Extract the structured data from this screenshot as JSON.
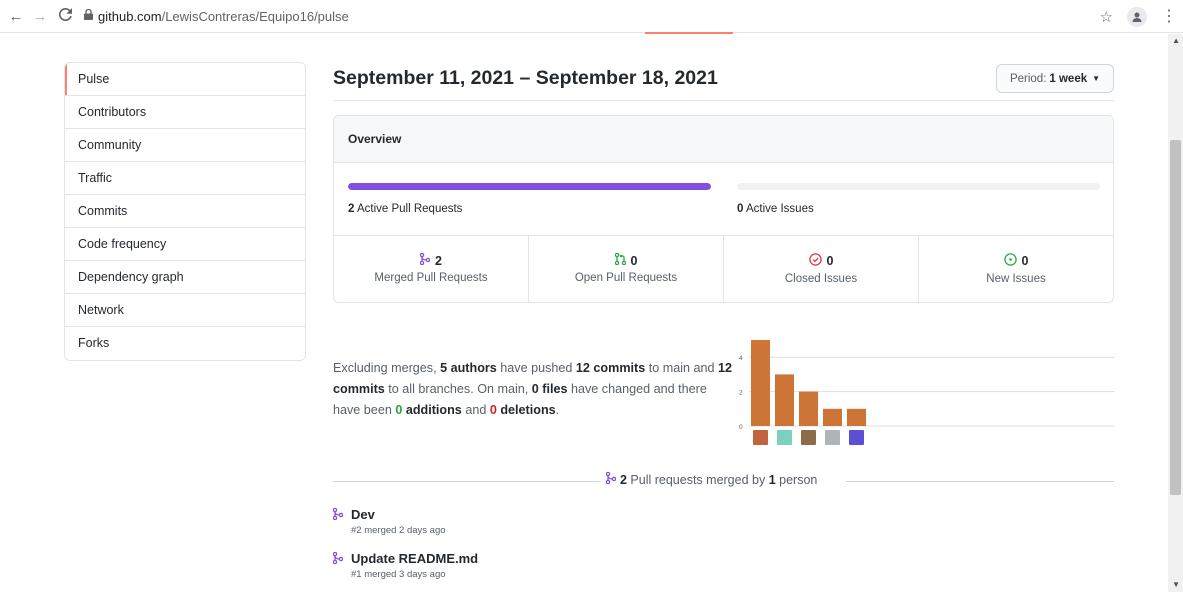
{
  "browser": {
    "back": "←",
    "forward": "→",
    "reload": "C",
    "url_host": "github.com",
    "url_path": "/LewisContreras/Equipo16/pulse"
  },
  "sidebar": {
    "items": [
      {
        "label": "Pulse",
        "active": true
      },
      {
        "label": "Contributors"
      },
      {
        "label": "Community"
      },
      {
        "label": "Traffic"
      },
      {
        "label": "Commits"
      },
      {
        "label": "Code frequency"
      },
      {
        "label": "Dependency graph"
      },
      {
        "label": "Network"
      },
      {
        "label": "Forks"
      }
    ]
  },
  "header": {
    "date_range": "September 11, 2021 – September 18, 2021",
    "period_label": "Period:",
    "period_value": "1 week"
  },
  "overview": {
    "title": "Overview",
    "pull_requests_count": "2",
    "pull_requests_label": "Active Pull Requests",
    "pull_requests_bar_fraction": 1.0,
    "issues_count": "0",
    "issues_label": "Active Issues",
    "issues_bar_fraction": 0.0,
    "stats": [
      {
        "value": "2",
        "label": "Merged Pull Requests",
        "icon": "merge-icon"
      },
      {
        "value": "0",
        "label": "Open Pull Requests",
        "icon": "pull-request-icon"
      },
      {
        "value": "0",
        "label": "Closed Issues",
        "icon": "issue-closed-icon"
      },
      {
        "value": "0",
        "label": "New Issues",
        "icon": "issue-opened-icon"
      }
    ]
  },
  "summary": {
    "p1": "Excluding merges, ",
    "authors": "5 authors",
    "p2": " have pushed ",
    "commits_main": "12 commits",
    "p3": " to main and ",
    "commits_all": "12 commits",
    "p4": " to all branches. On main, ",
    "files": "0 files",
    "p5": " have changed and there have been ",
    "additions": "0",
    "additions_label": "additions",
    "p6": " and ",
    "deletions": "0",
    "deletions_label": "deletions",
    "p7": "."
  },
  "chart_data": {
    "type": "bar",
    "categories": [
      "author-1",
      "author-2",
      "author-3",
      "author-4",
      "author-5"
    ],
    "values": [
      5,
      3,
      2,
      1,
      1
    ],
    "y_ticks": [
      "4",
      "2",
      "0"
    ],
    "ylim": [
      0,
      5
    ],
    "grid": true,
    "bar_color": "#cd7536"
  },
  "merged": {
    "count": "2",
    "middle": " Pull requests merged by ",
    "people": "1",
    "tail": " person"
  },
  "pull_requests": [
    {
      "title": "Dev",
      "meta": "#2 merged 2 days ago"
    },
    {
      "title": "Update README.md",
      "meta": "#1 merged 3 days ago"
    }
  ],
  "colors": {
    "accent": "#f9826c",
    "merged_purple": "#8250df",
    "open_green": "#28a745",
    "closed_red": "#d73a49"
  }
}
